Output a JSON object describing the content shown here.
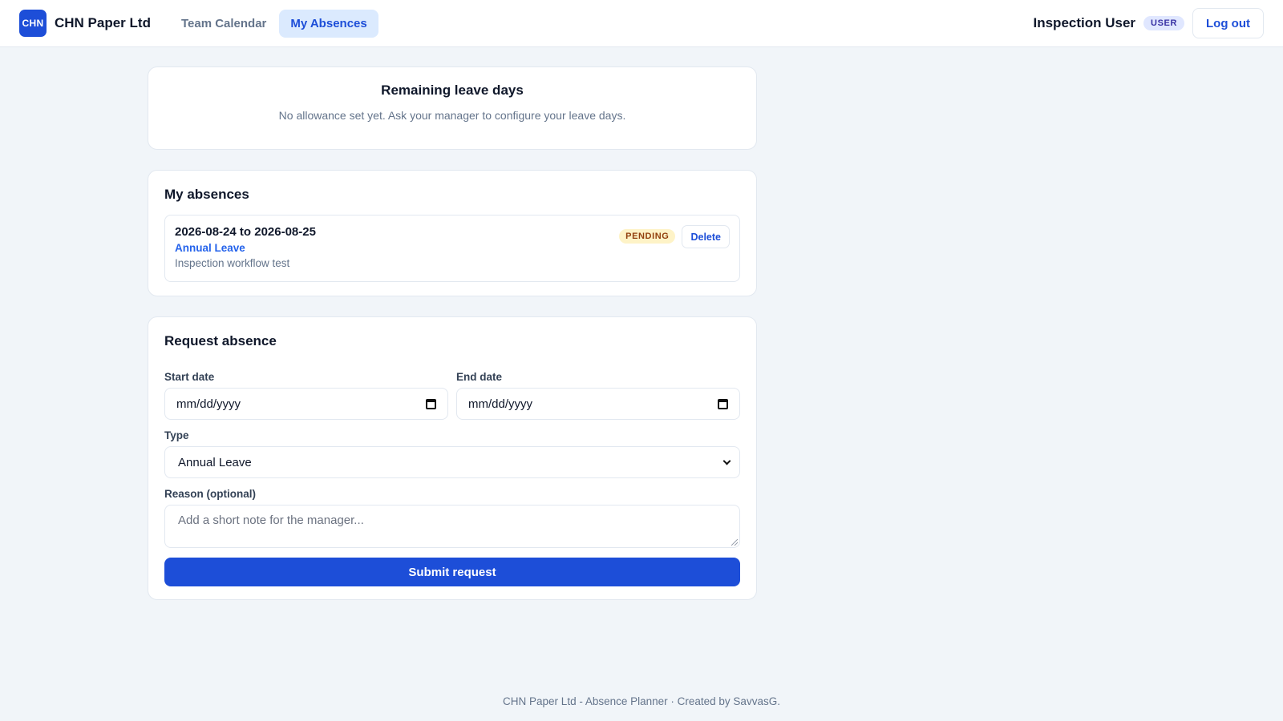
{
  "header": {
    "logo_text": "CHN",
    "brand": "CHN Paper Ltd",
    "nav": [
      {
        "label": "Team Calendar",
        "active": false
      },
      {
        "label": "My Absences",
        "active": true
      }
    ],
    "user_name": "Inspection User",
    "role_badge": "USER",
    "logout_label": "Log out"
  },
  "leave_card": {
    "title": "Remaining leave days",
    "note": "No allowance set yet. Ask your manager to configure your leave days."
  },
  "absences": {
    "title": "My absences",
    "items": [
      {
        "dates": "2026-08-24 to 2026-08-25",
        "type": "Annual Leave",
        "reason": "Inspection workflow test",
        "status": "PENDING",
        "delete_label": "Delete"
      }
    ]
  },
  "request_form": {
    "title": "Request absence",
    "start_label": "Start date",
    "start_value": "mm/dd/yyyy",
    "end_label": "End date",
    "end_value": "mm/dd/yyyy",
    "type_label": "Type",
    "type_value": "Annual Leave",
    "reason_label": "Reason (optional)",
    "reason_placeholder": "Add a short note for the manager...",
    "submit_label": "Submit request"
  },
  "footer": {
    "text": "CHN Paper Ltd - Absence Planner · Created by SavvasG."
  },
  "colors": {
    "primary": "#1d4ed8",
    "background": "#f1f5f9",
    "pending_bg": "#fef3c7",
    "pending_text": "#92400e"
  },
  "icons": [
    "calendar-icon",
    "chevron-down-icon",
    "resize-handle-icon"
  ]
}
